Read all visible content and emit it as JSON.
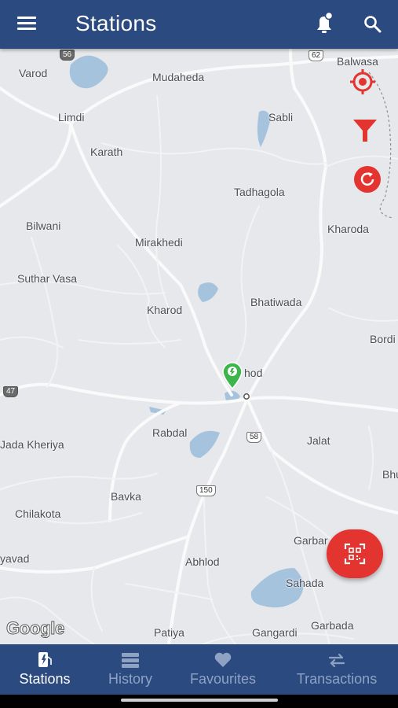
{
  "app_bar": {
    "title": "Stations",
    "menu_icon": "menu-icon",
    "notification_icon": "bell-icon",
    "search_icon": "search-icon",
    "color": "#2b4a80"
  },
  "map": {
    "places": [
      "Balwasa",
      "Varod",
      "Mudaheda",
      "Limdi",
      "Sabli",
      "Karath",
      "Tadhagola",
      "Kharoda",
      "Bilwani",
      "Mirakhedi",
      "Suthar Vasa",
      "Bhatiwada",
      "Kharod",
      "Bordi",
      "hod",
      "Rabdal",
      "Jalat",
      "Jada Kheriya",
      "Bavka",
      "Bhu",
      "Chilakota",
      "Garbar",
      "yavad",
      "Abhlod",
      "Sahada",
      "Garbada",
      "Patiya",
      "Gangardi"
    ],
    "route_shields": [
      "56",
      "62",
      "47",
      "58",
      "150"
    ],
    "attribution": "Google",
    "controls": {
      "locate_icon": "locate-icon",
      "filter_icon": "filter-icon",
      "refresh_icon": "refresh-icon"
    },
    "marker_icon": "ev-station-marker-icon",
    "accent_color": "#e3342f"
  },
  "fab": {
    "icon": "qr-scan-icon"
  },
  "bottom_nav": {
    "items": [
      {
        "label": "Stations",
        "icon": "ev-station-icon",
        "active": true
      },
      {
        "label": "History",
        "icon": "list-icon",
        "active": false
      },
      {
        "label": "Favourites",
        "icon": "heart-icon",
        "active": false
      },
      {
        "label": "Transactions",
        "icon": "swap-icon",
        "active": false
      }
    ]
  }
}
